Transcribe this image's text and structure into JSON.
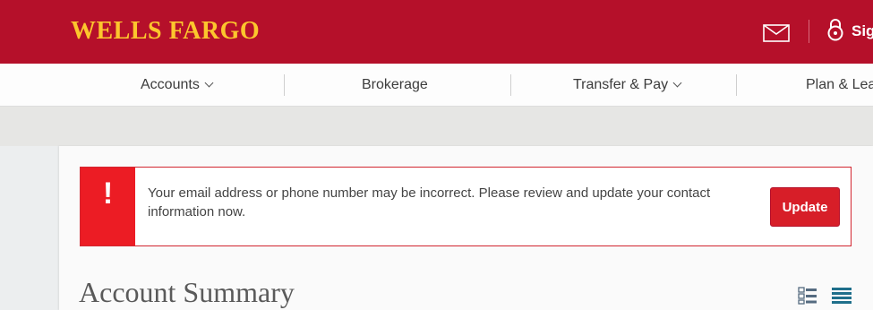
{
  "brand": {
    "logo_text": "WELLS FARGO",
    "header_color": "#b5102a",
    "logo_color": "#fcc62d"
  },
  "header": {
    "sign_on_label": "Sig"
  },
  "nav": {
    "items": [
      {
        "label": "Accounts"
      },
      {
        "label": "Brokerage"
      },
      {
        "label": "Transfer & Pay"
      },
      {
        "label": "Plan & Lea"
      }
    ]
  },
  "alert": {
    "icon_text": "!",
    "message": "Your email address or phone number may be incorrect. Please review and update your contact information now.",
    "button_label": "Update",
    "accent_color": "#ec1c24"
  },
  "main": {
    "title": "Account Summary"
  }
}
